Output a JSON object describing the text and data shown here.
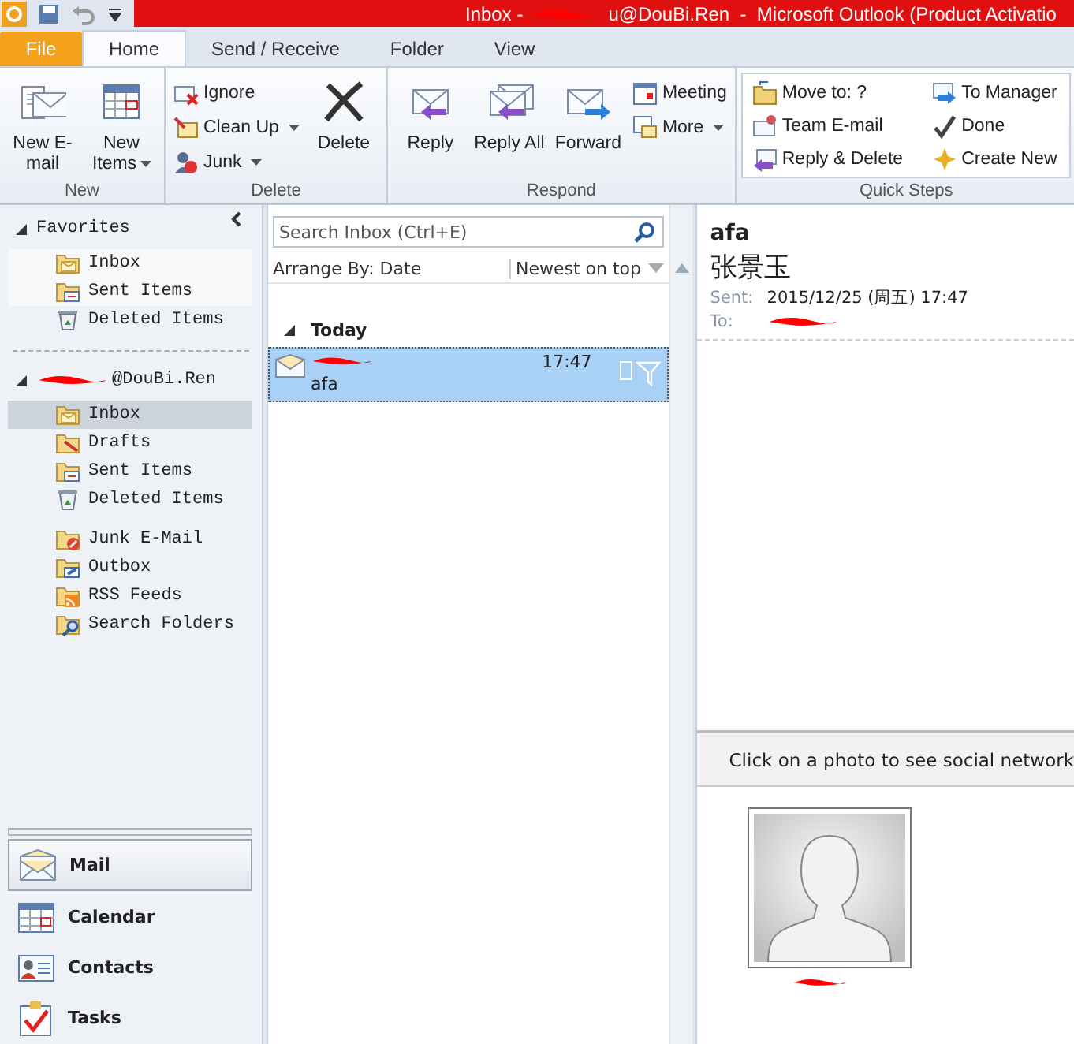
{
  "title_bar": {
    "title_start": "Inbox -",
    "title_end": "u@DouBi.Ren  -  Microsoft Outlook (Product Activatio"
  },
  "ribbon_tabs": [
    {
      "label": "File",
      "kind": "file",
      "selected": false
    },
    {
      "label": "Home",
      "kind": "tab",
      "selected": true
    },
    {
      "label": "Send / Receive",
      "kind": "tab",
      "selected": false
    },
    {
      "label": "Folder",
      "kind": "tab",
      "selected": false
    },
    {
      "label": "View",
      "kind": "tab",
      "selected": false
    }
  ],
  "ribbon_groups": [
    {
      "label": "New",
      "columns": [
        {
          "kind": "large",
          "items": [
            {
              "label": "New E-mail",
              "dropdown": false
            }
          ]
        },
        {
          "kind": "large",
          "items": [
            {
              "label": "New Items",
              "dropdown": true
            }
          ]
        }
      ]
    },
    {
      "label": "Delete",
      "columns": [
        {
          "kind": "small",
          "items": [
            {
              "label": "Ignore",
              "dropdown": false
            },
            {
              "label": "Clean Up",
              "dropdown": true
            },
            {
              "label": "Junk",
              "dropdown": true
            }
          ]
        },
        {
          "kind": "large",
          "items": [
            {
              "label": "Delete",
              "dropdown": false
            }
          ]
        }
      ]
    },
    {
      "label": "Respond",
      "columns": [
        {
          "kind": "large",
          "items": [
            {
              "label": "Reply",
              "dropdown": false
            }
          ]
        },
        {
          "kind": "large",
          "items": [
            {
              "label": "Reply All",
              "dropdown": false
            }
          ]
        },
        {
          "kind": "large",
          "items": [
            {
              "label": "Forward",
              "dropdown": false
            }
          ]
        },
        {
          "kind": "small",
          "items": [
            {
              "label": "Meeting",
              "dropdown": false
            },
            {
              "label": "More",
              "dropdown": true
            }
          ]
        }
      ]
    },
    {
      "label": "Quick Steps",
      "columns": [
        {
          "kind": "quick",
          "items": [
            {
              "label": "Move to: ?",
              "dropdown": false
            },
            {
              "label": "Team E-mail",
              "dropdown": false
            },
            {
              "label": "Reply & Delete",
              "dropdown": false
            }
          ]
        },
        {
          "kind": "quick",
          "items": [
            {
              "label": "To Manager",
              "dropdown": false
            },
            {
              "label": "Done",
              "dropdown": false
            },
            {
              "label": "Create New",
              "dropdown": false
            }
          ]
        }
      ]
    }
  ],
  "favorites": {
    "label": "Favorites",
    "expanded": true,
    "items": [
      {
        "label": "Inbox",
        "selected": false
      },
      {
        "label": "Sent Items",
        "selected": false
      },
      {
        "label": "Deleted Items",
        "selected": false
      }
    ]
  },
  "account": {
    "label": "@DouBi.Ren",
    "expanded": true,
    "items": [
      {
        "label": "Inbox",
        "selected": true
      },
      {
        "label": "Drafts",
        "selected": false
      },
      {
        "label": "Sent Items",
        "selected": false
      },
      {
        "label": "Deleted Items",
        "selected": false
      },
      {
        "label": "Junk E-Mail",
        "selected": false
      },
      {
        "label": "Outbox",
        "selected": false
      },
      {
        "label": "RSS Feeds",
        "selected": false
      },
      {
        "label": "Search Folders",
        "selected": false
      }
    ]
  },
  "nav_buttons": [
    {
      "label": "Mail",
      "selected": true
    },
    {
      "label": "Calendar",
      "selected": false
    },
    {
      "label": "Contacts",
      "selected": false
    },
    {
      "label": "Tasks",
      "selected": false
    }
  ],
  "search": {
    "placeholder": "Search Inbox (Ctrl+E)"
  },
  "arrange": {
    "by": "Arrange By: Date",
    "order": "Newest on top"
  },
  "message_groups": [
    {
      "label": "Today",
      "expanded": true,
      "messages": [
        {
          "time": "17:47",
          "subject": "afa",
          "selected": true
        }
      ]
    }
  ],
  "reading_pane": {
    "subject": "afa",
    "sender": "张景玉",
    "sent_label": "Sent:",
    "sent": "2015/12/25 (周五) 17:47",
    "to_label": "To:",
    "social_text": "Click on a photo to see social network"
  }
}
